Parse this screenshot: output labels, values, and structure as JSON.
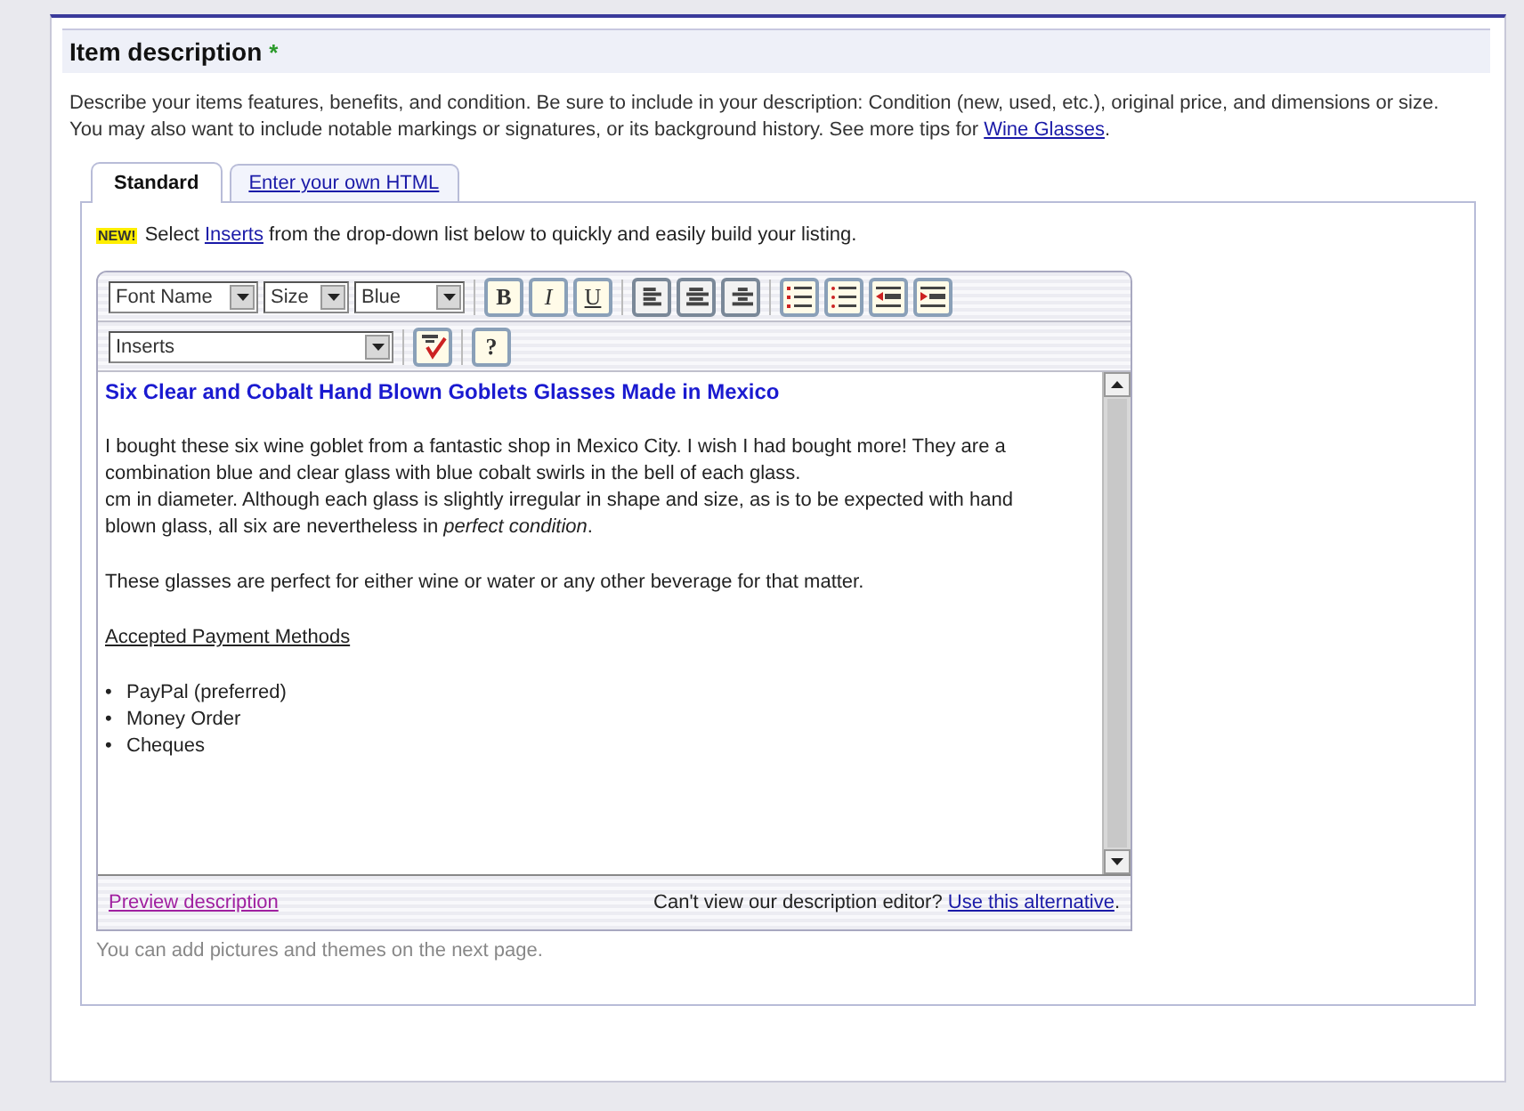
{
  "section": {
    "title": "Item description",
    "required_mark": "*"
  },
  "intro": {
    "text": "Describe your items features, benefits, and condition. Be sure to include in your description: Condition (new, used, etc.), original price, and dimensions or size. You may also want to include notable markings or signatures, or its background history. See more tips for ",
    "link": "Wine Glasses",
    "end": "."
  },
  "tabs": [
    {
      "label": "Standard",
      "selected": true
    },
    {
      "label": "Enter your own HTML",
      "selected": false
    }
  ],
  "notice": {
    "badge": "NEW!",
    "before": "Select ",
    "link": "Inserts",
    "after": " from the drop-down list below to quickly and easily build your listing."
  },
  "toolbar": {
    "selects": [
      {
        "value": "Font Name"
      },
      {
        "value": "Size"
      },
      {
        "value": "Blue"
      }
    ],
    "format_buttons": [
      {
        "label": "B",
        "kind": "bold"
      },
      {
        "label": "I",
        "kind": "italic"
      },
      {
        "label": "U",
        "kind": "underline"
      }
    ],
    "align_buttons": [
      {
        "kind": "left"
      },
      {
        "kind": "center"
      },
      {
        "kind": "right"
      }
    ],
    "list_buttons": [
      {
        "kind": "numbered"
      },
      {
        "kind": "bulleted"
      },
      {
        "kind": "outdent"
      },
      {
        "kind": "indent"
      }
    ],
    "inserts": {
      "value": "Inserts"
    },
    "help_button": "?"
  },
  "content": {
    "heading": "Six Clear and Cobalt Hand Blown Goblets Glasses Made in Mexico",
    "blocks": [
      {
        "kind": "paragraph",
        "text": "I bought these six wine goblet from a fantastic shop in Mexico City. I wish I had bought more! They are a combination blue and clear glass with blue cobalt swirls in the bell of each glass."
      },
      {
        "kind": "paragraph",
        "text": "cm in diameter. Although each glass is slightly irregular in shape and size, as is to be expected with hand blown glass, all six are nevertheless in *perfect condition*."
      },
      {
        "kind": "gap"
      },
      {
        "kind": "paragraph",
        "text": "These glasses are perfect for either wine or water or any other beverage for that matter."
      },
      {
        "kind": "gap"
      },
      {
        "kind": "subheading",
        "text": "Accepted Payment Methods"
      },
      {
        "kind": "gap"
      },
      {
        "kind": "list",
        "items": [
          {
            "marker": "•",
            "text": "PayPal (preferred)"
          },
          {
            "marker": "•",
            "text": "Money Order"
          },
          {
            "marker": "•",
            "text": "Cheques"
          }
        ]
      }
    ]
  },
  "footer": {
    "preview_link": "Preview description",
    "question": "Can't view our description editor? ",
    "alt_link": "Use this alternative",
    "end": "."
  },
  "hint": "You can add pictures and themes on the next page."
}
